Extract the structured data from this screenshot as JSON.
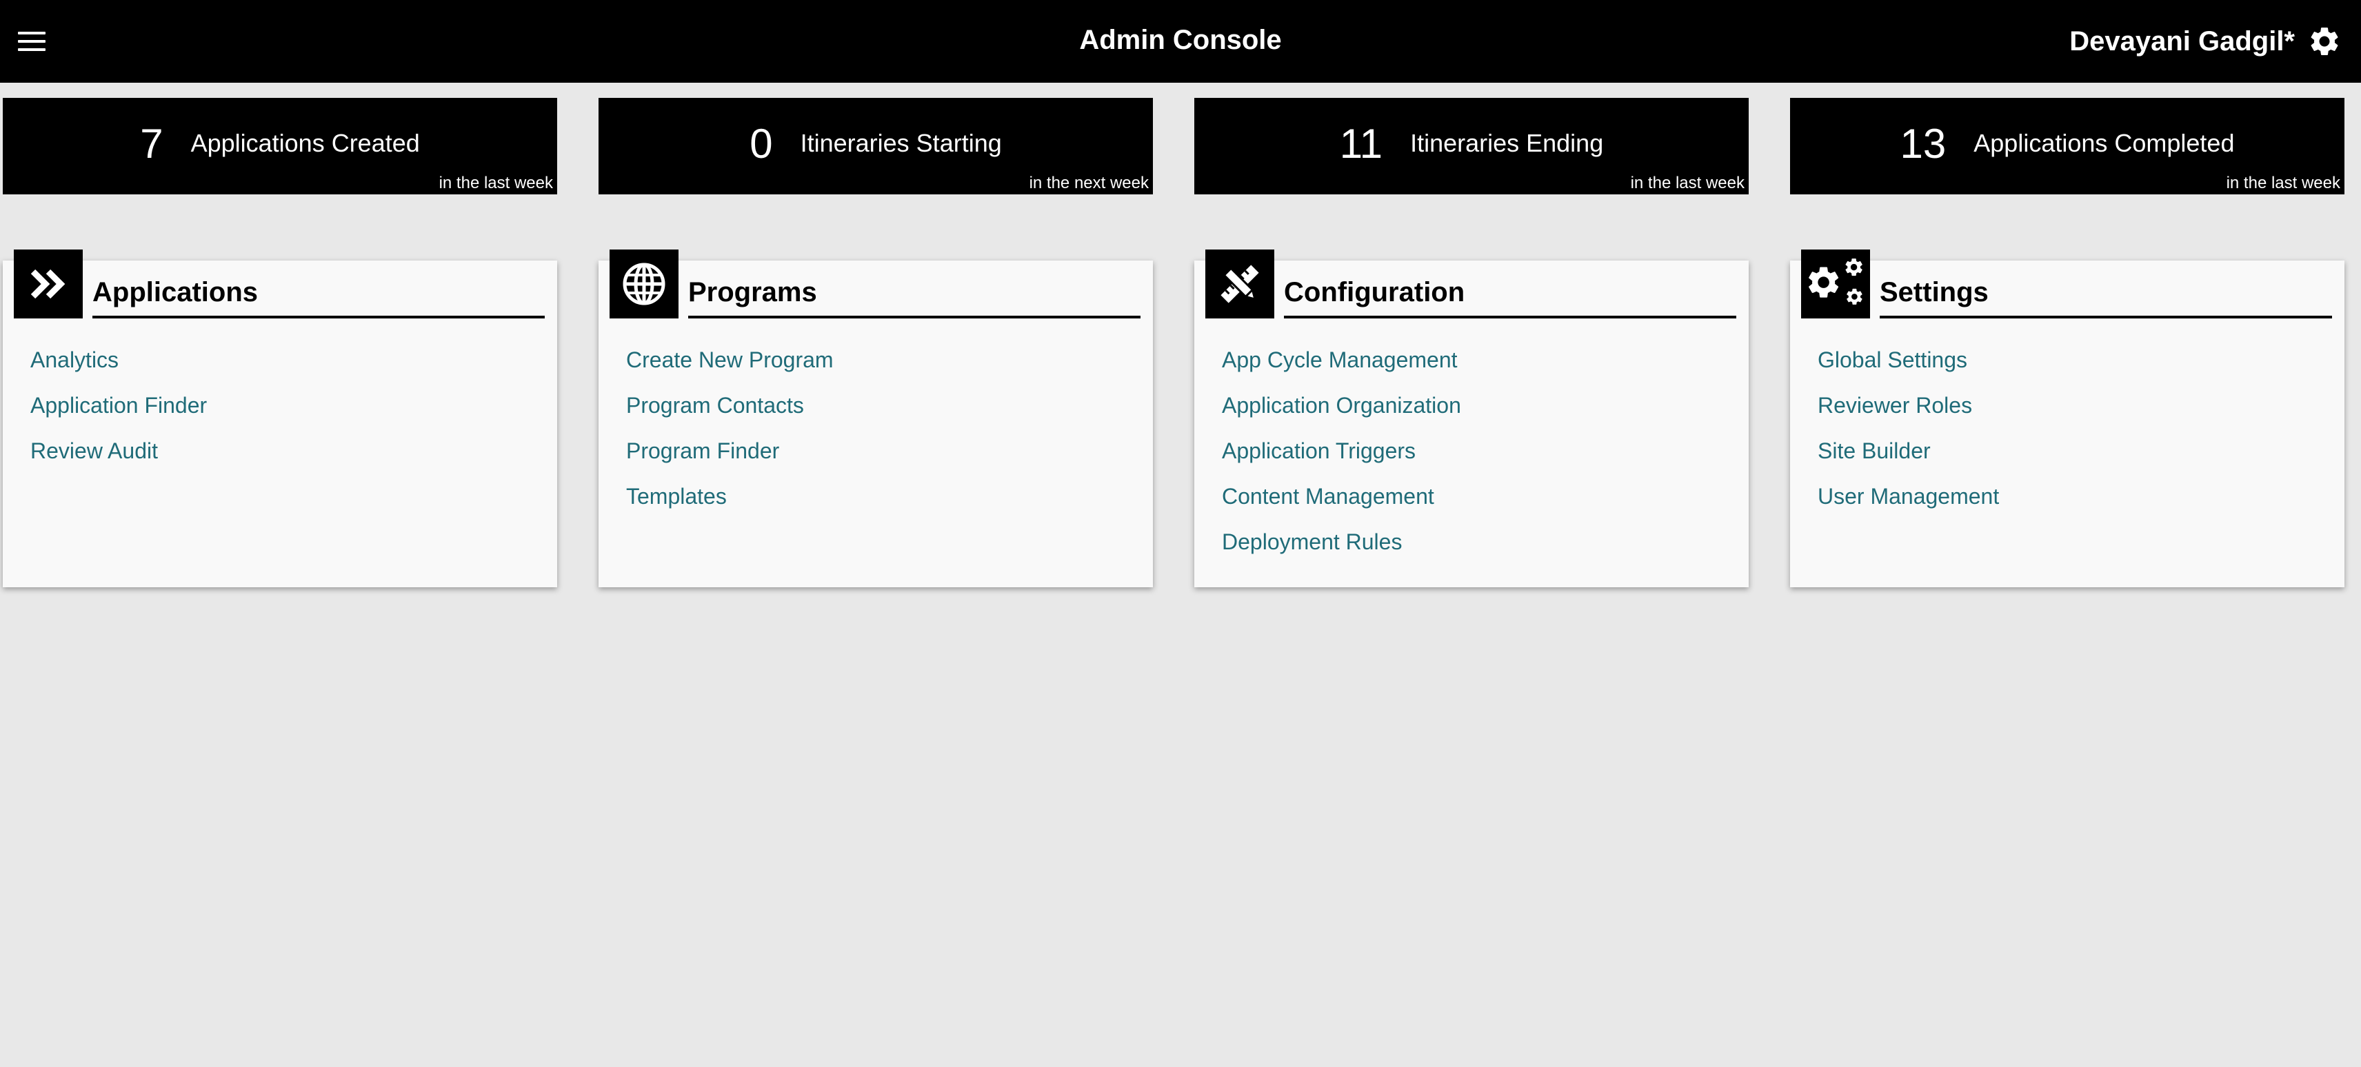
{
  "header": {
    "title": "Admin Console",
    "user_name": "Devayani Gadgil*",
    "menu_icon": "hamburger-menu-icon",
    "settings_icon": "gear-icon"
  },
  "stats": [
    {
      "value": "7",
      "label": "Applications Created",
      "period": "in the last week"
    },
    {
      "value": "0",
      "label": "Itineraries Starting",
      "period": "in the next week"
    },
    {
      "value": "11",
      "label": "Itineraries Ending",
      "period": "in the last week"
    },
    {
      "value": "13",
      "label": "Applications Completed",
      "period": "in the last week"
    }
  ],
  "cards": [
    {
      "title": "Applications",
      "icon": "double-chevron-right-icon",
      "links": [
        "Analytics",
        "Application Finder",
        "Review Audit"
      ]
    },
    {
      "title": "Programs",
      "icon": "globe-icon",
      "links": [
        "Create New Program",
        "Program Contacts",
        "Program Finder",
        "Templates"
      ]
    },
    {
      "title": "Configuration",
      "icon": "pencil-ruler-icon",
      "links": [
        "App Cycle Management",
        "Application Organization",
        "Application Triggers",
        "Content Management",
        "Deployment Rules"
      ]
    },
    {
      "title": "Settings",
      "icon": "gears-icon",
      "links": [
        "Global Settings",
        "Reviewer Roles",
        "Site Builder",
        "User Management"
      ]
    }
  ],
  "colors": {
    "header_bg": "#000000",
    "page_bg": "#e8e8e8",
    "card_bg": "#f9f9f9",
    "link": "#1f6b78"
  }
}
